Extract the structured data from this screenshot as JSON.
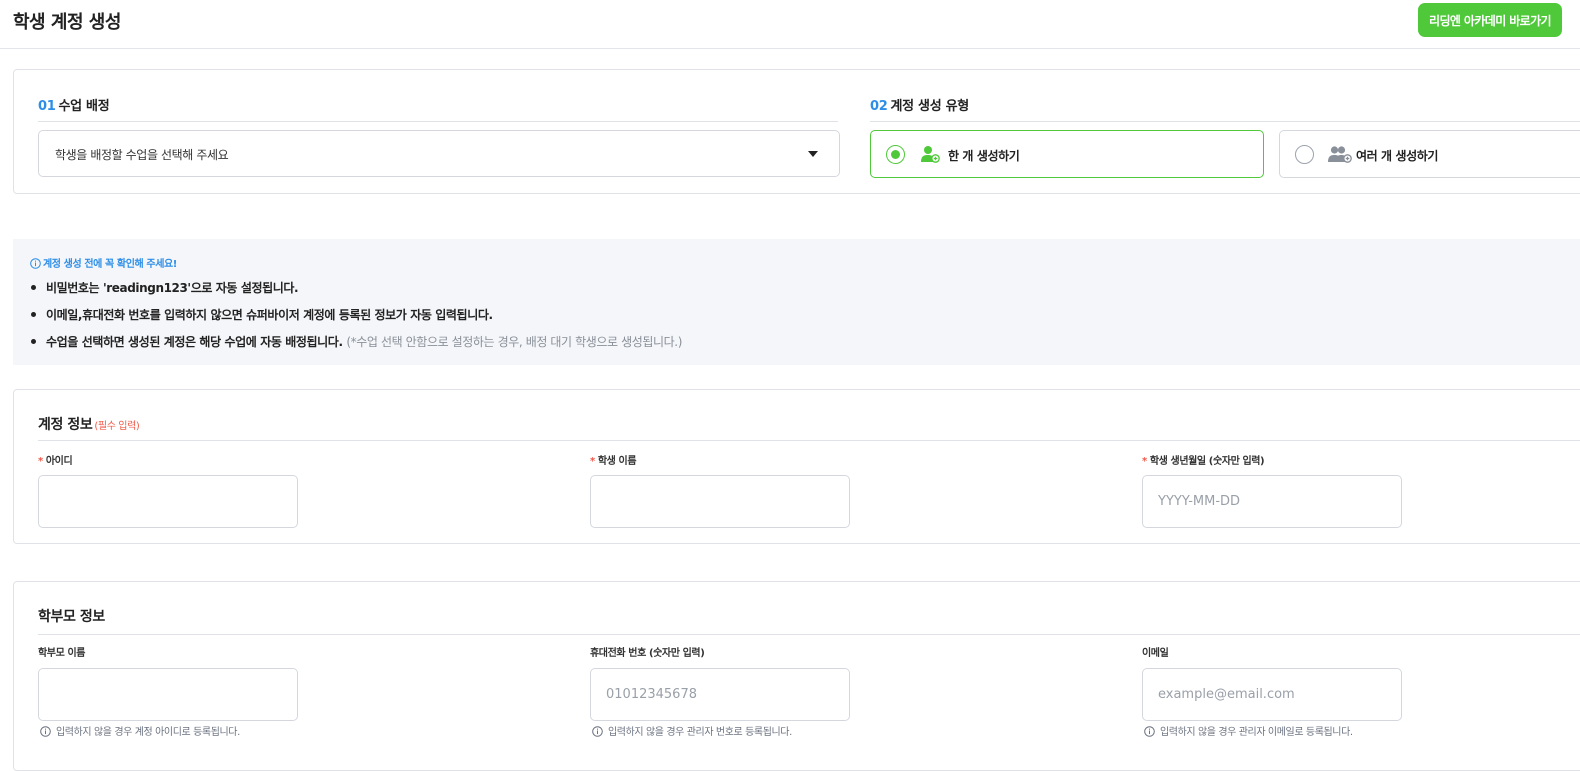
{
  "header": {
    "title": "학생 계정 생성",
    "academy_button": "리딩엔 아카데미 바로가기"
  },
  "assign": {
    "num": "01",
    "title": "수업 배정",
    "select_placeholder": "학생을 배정할 수업을 선택해 주세요"
  },
  "create_type": {
    "num": "02",
    "title": "계정 생성 유형",
    "options": [
      {
        "label": "한 개 생성하기",
        "selected": true
      },
      {
        "label": "여러 개 생성하기",
        "selected": false
      }
    ]
  },
  "notice": {
    "title": "계정 생성 전에 꼭 확인해 주세요!",
    "items": [
      {
        "text": "비밀번호는 'readingn123'으로 자동 설정됩니다."
      },
      {
        "text": "이메일,휴대전화 번호를 입력하지 않으면 슈퍼바이저 계정에 등록된 정보가 자동 입력됩니다."
      },
      {
        "text": "수업을 선택하면 생성된 계정은 해당 수업에 자동 배정됩니다.",
        "note": "(*수업 선택 안함으로 설정하는 경우, 배정 대기 학생으로 생성됩니다.)"
      }
    ]
  },
  "account": {
    "title": "계정 정보",
    "required_note": "(필수 입력)",
    "fields": [
      {
        "label": "아이디",
        "placeholder": "",
        "value": ""
      },
      {
        "label": "학생 이름",
        "placeholder": "",
        "value": ""
      },
      {
        "label": "학생 생년월일 (숫자만 입력)",
        "placeholder": "YYYY-MM-DD",
        "value": ""
      }
    ]
  },
  "parent": {
    "title": "학부모 정보",
    "fields": [
      {
        "label": "학부모 이름",
        "placeholder": "",
        "value": "",
        "hint": "입력하지 않을 경우 계정 아이디로 등록됩니다."
      },
      {
        "label": "휴대전화 번호 (숫자만 입력)",
        "placeholder": "01012345678",
        "value": "",
        "hint": "입력하지 않을 경우 관리자 번호로 등록됩니다."
      },
      {
        "label": "이메일",
        "placeholder": "example@email.com",
        "value": "",
        "hint": "입력하지 않을 경우 관리자 이메일로 등록됩니다."
      }
    ]
  },
  "colors": {
    "accent_green": "#4fc93a",
    "accent_blue": "#2d8ee8",
    "required_red": "#f05a4a"
  }
}
